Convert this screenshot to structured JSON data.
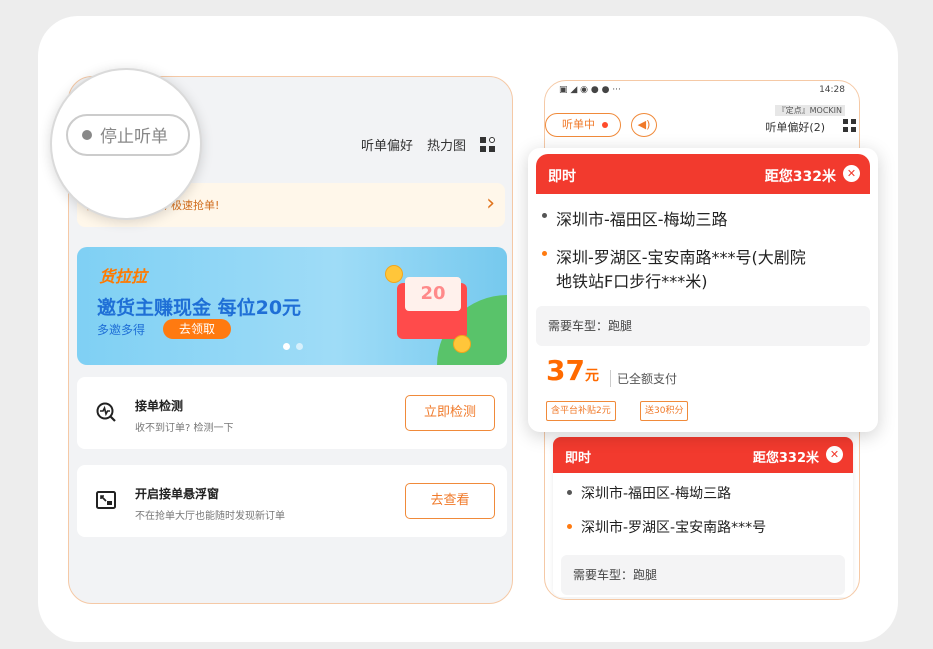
{
  "left": {
    "stop_label": "停止听单",
    "header_links": [
      "听单偏好",
      "热力图"
    ],
    "vip_text": "成为货拉拉会员, 极速抢单!",
    "banner": {
      "brand": "货拉拉",
      "title": "邀货主赚现金 每位20元",
      "sub": "多邀多得",
      "button": "去领取",
      "envelope_text": "20"
    },
    "cards": [
      {
        "title": "接单检测",
        "desc": "收不到订单? 检测一下",
        "button": "立即检测"
      },
      {
        "title": "开启接单悬浮窗",
        "desc": "不在抢单大厅也能随时发现新订单",
        "button": "去查看"
      }
    ]
  },
  "right": {
    "status_time": "14:28",
    "mock_label": "『定点』MOCKIN",
    "listening": "听单中",
    "pref": "听单偏好(2)",
    "order_bg": {
      "type": "即时",
      "distance": "距您332米",
      "from": "深圳市-福田区-梅坳三路",
      "to": "深圳市-罗湖区-宝安南路***号",
      "vehicle": "需要车型：跑腿"
    }
  },
  "popup": {
    "type": "即时",
    "distance": "距您332米",
    "from": "深圳市-福田区-梅坳三路",
    "to_line1": "深圳-罗湖区-宝安南路***号(大剧院",
    "to_line2": "地铁站F口步行***米)",
    "vehicle": "需要车型：跑腿",
    "price": "37",
    "price_unit": "元",
    "paid": "已全额支付",
    "tags": [
      "含平台补贴2元",
      "送30积分"
    ]
  },
  "colors": {
    "accent": "#f07a2a",
    "header_red": "#f23a2e",
    "price": "#ff6a00"
  }
}
